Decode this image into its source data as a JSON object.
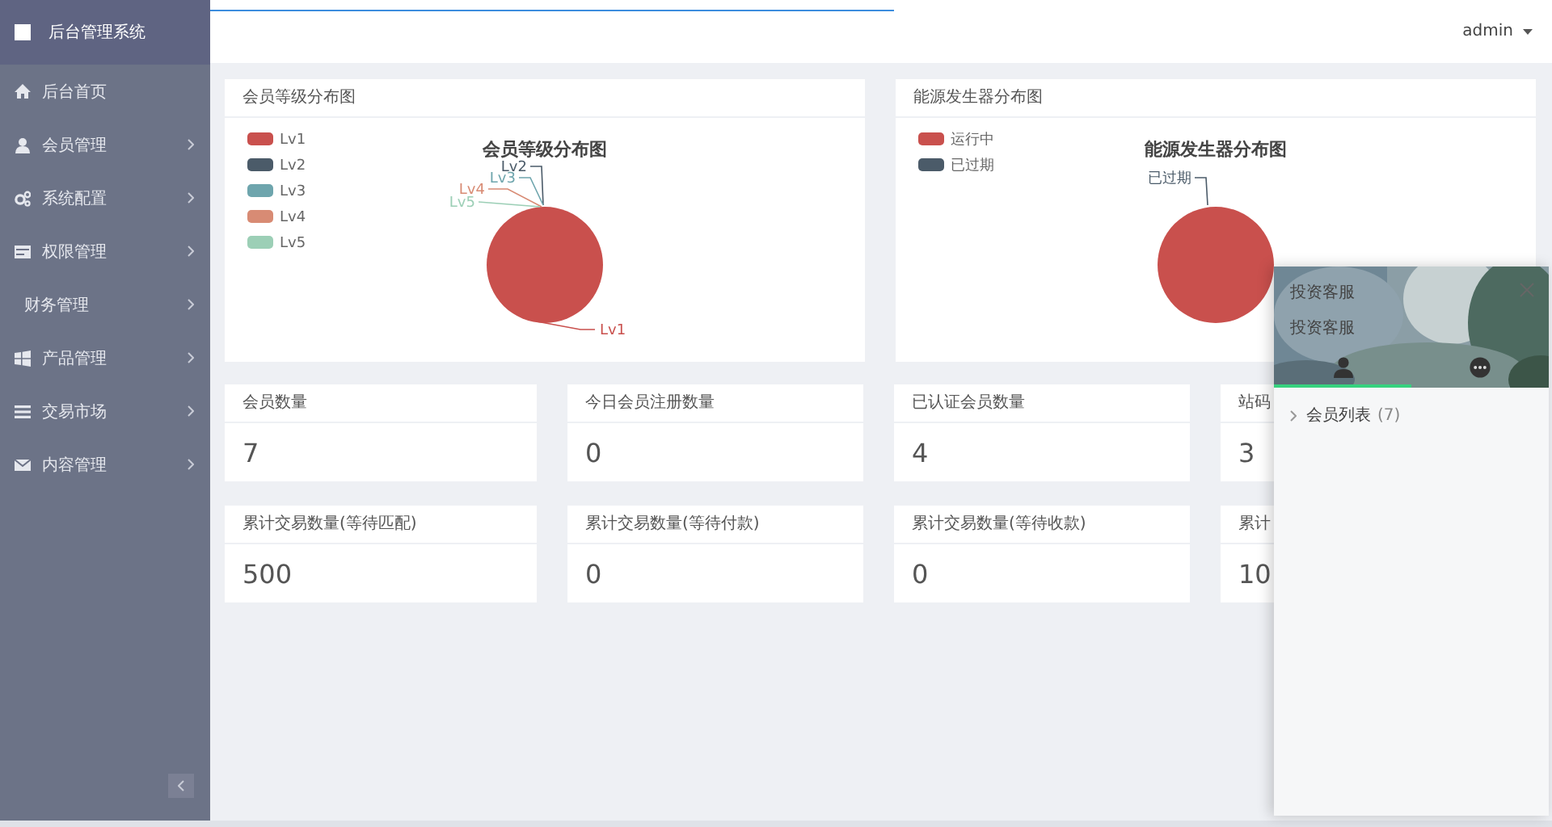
{
  "app_title": "后台管理系统",
  "sidebar": {
    "items": [
      {
        "label": "后台首页",
        "has_children": false
      },
      {
        "label": "会员管理",
        "has_children": true
      },
      {
        "label": "系统配置",
        "has_children": true
      },
      {
        "label": "权限管理",
        "has_children": true
      },
      {
        "label": "财务管理",
        "has_children": true
      },
      {
        "label": "产品管理",
        "has_children": true
      },
      {
        "label": "交易市场",
        "has_children": true
      },
      {
        "label": "内容管理",
        "has_children": true
      }
    ]
  },
  "header": {
    "user": "admin",
    "loading_bar": {
      "level": 0.51
    }
  },
  "charts": [
    {
      "header": "会员等级分布图",
      "title": "会员等级分布图",
      "legend": [
        {
          "label": "Lv1",
          "color": "#c9504d",
          "pie_label": "Lv1"
        },
        {
          "label": "Lv2",
          "color": "#4b5b69",
          "pie_label": "Lv2"
        },
        {
          "label": "Lv3",
          "color": "#6ea5ad",
          "pie_label": "Lv3"
        },
        {
          "label": "Lv4",
          "color": "#d88b74",
          "pie_label": "Lv4"
        },
        {
          "label": "Lv5",
          "color": "#9ccfb6",
          "pie_label": "Lv5"
        }
      ]
    },
    {
      "header": "能源发生器分布图",
      "title": "能源发生器分布图",
      "legend": [
        {
          "label": "运行中",
          "color": "#c9504d"
        },
        {
          "label": "已过期",
          "color": "#4b5b69",
          "pie_label": "已过期"
        }
      ]
    }
  ],
  "stats": [
    [
      {
        "label": "会员数量",
        "value": "7"
      },
      {
        "label": "今日会员注册数量",
        "value": "0"
      },
      {
        "label": "已认证会员数量",
        "value": "4"
      },
      {
        "label": "站码",
        "value": "3"
      }
    ],
    [
      {
        "label": "累计交易数量(等待匹配)",
        "value": "500"
      },
      {
        "label": "累计交易数量(等待付款)",
        "value": "0"
      },
      {
        "label": "累计交易数量(等待收款)",
        "value": "0"
      },
      {
        "label": "累计",
        "value": "10"
      }
    ]
  ],
  "chat_panel": {
    "title": "投资客服",
    "subtitle": "投资客服",
    "tabs": [
      {
        "selected": true
      },
      {
        "selected": false
      }
    ],
    "groups": [
      {
        "label": "会员列表",
        "count": "(7)",
        "expanded": false
      }
    ]
  }
}
